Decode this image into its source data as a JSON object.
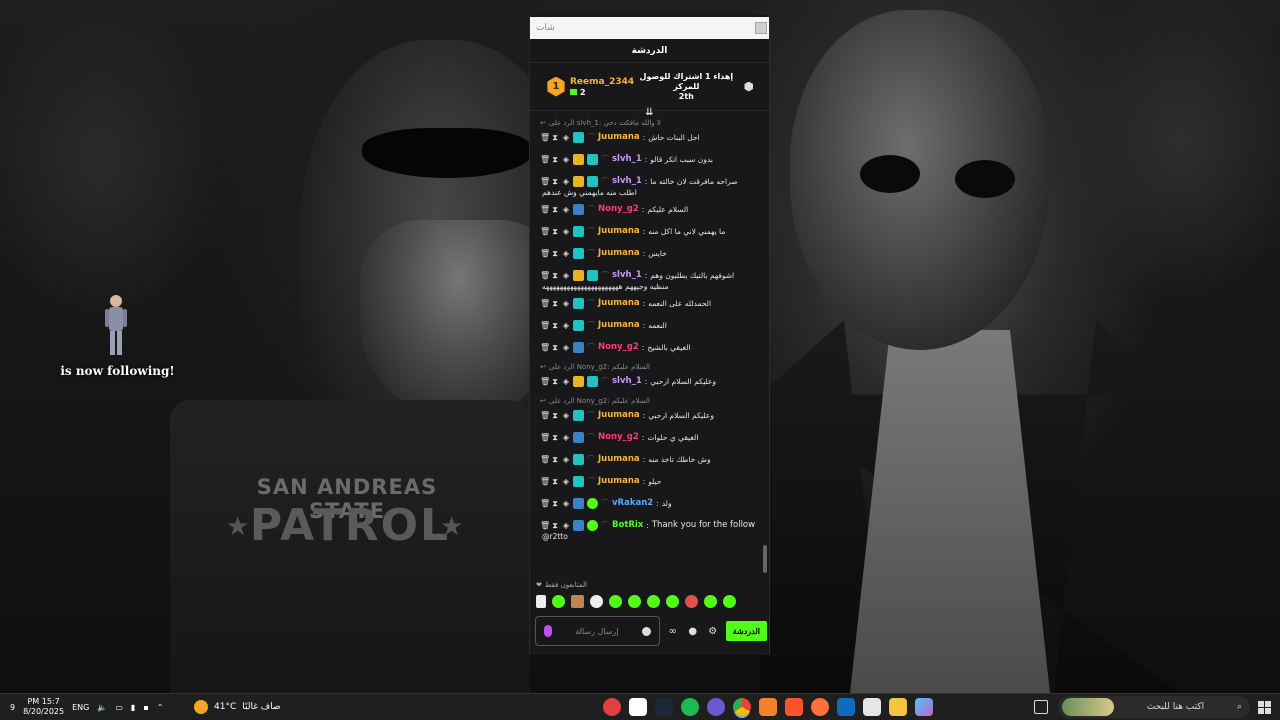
{
  "wallpaper": {
    "patch_line1": "SAN ANDREAS STATE",
    "patch_line2": "PATROL",
    "star": "★"
  },
  "alert": {
    "text": "is now following!"
  },
  "chat": {
    "topbar_placeholder": "شات",
    "header_title": "الدردشة",
    "pinned": {
      "rank": "1",
      "user": "Reema_2344",
      "count": "2",
      "gift_text_line1": "إهداء 1 اشتراك للوصول للمركز",
      "gift_text_line2": "2th"
    },
    "scroll_icon": "⇊",
    "messages": [
      {
        "reply": "الرد على slvh_1: لا والله مافكت دحي",
        "user": "Juumana",
        "color": "gold",
        "badges": [
          "sub"
        ],
        "text": "اجل البنات حاش"
      },
      {
        "reply": "",
        "user": "slvh_1",
        "color": "purple",
        "badges": [
          "crown",
          "sub"
        ],
        "text": "بدون سبب اتكر قالو"
      },
      {
        "reply": "",
        "user": "slvh_1",
        "color": "purple",
        "badges": [
          "crown",
          "sub"
        ],
        "text": "صراحه مافرقت لان خالته ما",
        "cont": "اطلب منه مايهمني وش عندهم"
      },
      {
        "reply": "",
        "user": "Nony_g2",
        "color": "red",
        "badges": [
          "sword"
        ],
        "text": "السلام عليكم"
      },
      {
        "reply": "",
        "user": "Juumana",
        "color": "gold",
        "badges": [
          "sub"
        ],
        "text": "ما يهمني لاني ما اكل منه"
      },
      {
        "reply": "",
        "user": "Juumana",
        "color": "gold",
        "badges": [
          "sub"
        ],
        "text": "خايس"
      },
      {
        "reply": "",
        "user": "slvh_1",
        "color": "purple",
        "badges": [
          "crown",
          "sub"
        ],
        "text": "اشوفهم بالتيك يطلبون وهم",
        "cont": "منظيه وجيههم ههههههههههههههههههههههه"
      },
      {
        "reply": "",
        "user": "Juumana",
        "color": "gold",
        "badges": [
          "sub"
        ],
        "text": "الحمدلله على النعمه"
      },
      {
        "reply": "",
        "user": "Juumana",
        "color": "gold",
        "badges": [
          "sub"
        ],
        "text": "النعمه"
      },
      {
        "reply": "",
        "user": "Nony_g2",
        "color": "red",
        "badges": [
          "sword"
        ],
        "text": "الغيقي بالشيخ"
      },
      {
        "reply": "الرد على Nony_g2: السلام عليكم",
        "user": "slvh_1",
        "color": "purple",
        "badges": [
          "crown",
          "sub"
        ],
        "text": "وعليكم السلام ارحبي"
      },
      {
        "reply": "الرد على Nony_g2: السلام عليكم",
        "user": "Juumana",
        "color": "gold",
        "badges": [
          "sub"
        ],
        "text": "وعليكم السلام ارحبي"
      },
      {
        "reply": "",
        "user": "Nony_g2",
        "color": "red",
        "badges": [
          "sword"
        ],
        "text": "الغيقي ي حلوات"
      },
      {
        "reply": "",
        "user": "Juumana",
        "color": "gold",
        "badges": [
          "sub"
        ],
        "text": "وش خاطك تاخذ منه"
      },
      {
        "reply": "",
        "user": "Juumana",
        "color": "gold",
        "badges": [
          "sub"
        ],
        "text": "حيلو"
      },
      {
        "reply": "",
        "user": "vRakan2",
        "color": "blue",
        "badges": [
          "sword",
          "verify"
        ],
        "text": "ولد"
      },
      {
        "reply": "",
        "user": "BotRix",
        "color": "green",
        "badges": [
          "sword",
          "verify"
        ],
        "text": "Thank you for the follow",
        "cont": "@r2tto",
        "en": true
      }
    ],
    "followers_only": "المتابعون فقط",
    "input_placeholder": "إرسال رسالة",
    "send_label": "الدردشة",
    "infinity": "∞",
    "gear": "⚙"
  },
  "taskbar": {
    "time": "PM 15:7",
    "date": "8/20/2025",
    "lang": "ENG",
    "notif_count": "9",
    "temp": "41°C",
    "weather": "صاف غالبًا",
    "search_placeholder": "اكتب هنا للبحث"
  },
  "colors": {
    "kick_green": "#53fc18",
    "gold": "#f5b342",
    "purple": "#c79bf2",
    "red": "#ff3c6e",
    "blue": "#5aa8ff"
  }
}
